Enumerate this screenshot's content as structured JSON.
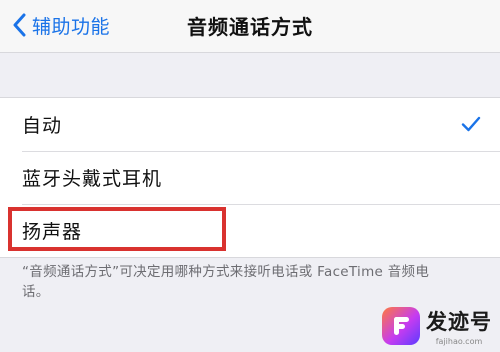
{
  "nav": {
    "back_label": "辅助功能",
    "title": "音频通话方式"
  },
  "options": [
    {
      "label": "自动",
      "selected": true
    },
    {
      "label": "蓝牙头戴式耳机",
      "selected": false
    },
    {
      "label": "扬声器",
      "selected": false
    }
  ],
  "footer": {
    "note": "“音频通话方式”可决定用哪种方式来接听电话或 FaceTime 音频电话。"
  },
  "watermark": {
    "name": "发迹号",
    "url": "fajihao.com"
  },
  "colors": {
    "accent": "#1a73e8",
    "highlight": "#d9322f",
    "background": "#efeff4"
  },
  "icons": {
    "back": "chevron-left-icon",
    "selected": "checkmark-icon",
    "watermark_logo": "fajihao-logo-icon"
  }
}
